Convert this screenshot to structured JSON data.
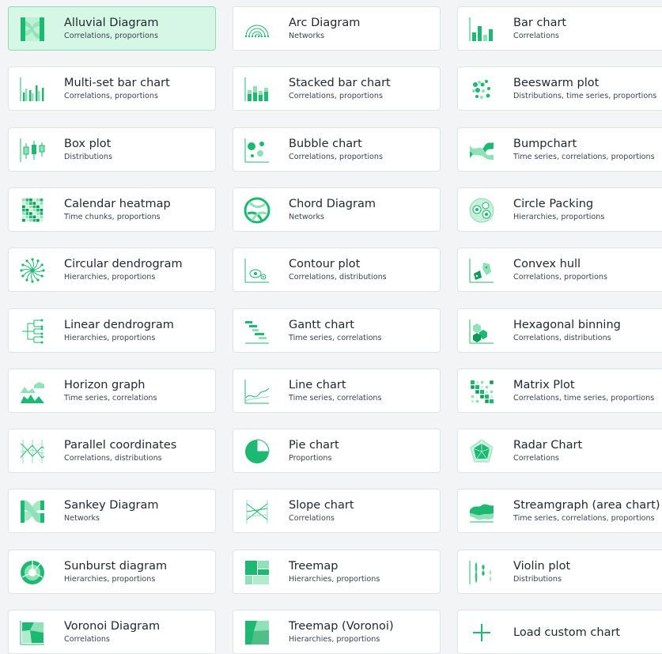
{
  "accent_color": "#1db872",
  "charts": [
    {
      "name": "Alluvial Diagram",
      "desc": "Correlations, proportions",
      "icon": "alluvial-diagram-icon",
      "selected": true
    },
    {
      "name": "Arc Diagram",
      "desc": "Networks",
      "icon": "arc-diagram-icon"
    },
    {
      "name": "Bar chart",
      "desc": "Correlations",
      "icon": "bar-chart-icon"
    },
    {
      "name": "Multi-set bar chart",
      "desc": "Correlations, proportions",
      "icon": "multi-set-bar-chart-icon"
    },
    {
      "name": "Stacked bar chart",
      "desc": "Correlations, proportions",
      "icon": "stacked-bar-chart-icon"
    },
    {
      "name": "Beeswarm plot",
      "desc": "Distributions, time series, proportions",
      "icon": "beeswarm-plot-icon"
    },
    {
      "name": "Box plot",
      "desc": "Distributions",
      "icon": "box-plot-icon"
    },
    {
      "name": "Bubble chart",
      "desc": "Correlations, proportions",
      "icon": "bubble-chart-icon"
    },
    {
      "name": "Bumpchart",
      "desc": "Time series, correlations, proportions",
      "icon": "bumpchart-icon"
    },
    {
      "name": "Calendar heatmap",
      "desc": "Time chunks, proportions",
      "icon": "calendar-heatmap-icon"
    },
    {
      "name": "Chord Diagram",
      "desc": "Networks",
      "icon": "chord-diagram-icon"
    },
    {
      "name": "Circle Packing",
      "desc": "Hierarchies, proportions",
      "icon": "circle-packing-icon"
    },
    {
      "name": "Circular dendrogram",
      "desc": "Hierarchies, proportions",
      "icon": "circular-dendrogram-icon"
    },
    {
      "name": "Contour plot",
      "desc": "Correlations, distributions",
      "icon": "contour-plot-icon"
    },
    {
      "name": "Convex hull",
      "desc": "Correlations, proportions",
      "icon": "convex-hull-icon"
    },
    {
      "name": "Linear dendrogram",
      "desc": "Hierarchies, proportions",
      "icon": "linear-dendrogram-icon"
    },
    {
      "name": "Gantt chart",
      "desc": "Time series, correlations",
      "icon": "gantt-chart-icon"
    },
    {
      "name": "Hexagonal binning",
      "desc": "Correlations, distributions",
      "icon": "hexagonal-binning-icon"
    },
    {
      "name": "Horizon graph",
      "desc": "Time series, correlations",
      "icon": "horizon-graph-icon"
    },
    {
      "name": "Line chart",
      "desc": "Time series, correlations",
      "icon": "line-chart-icon"
    },
    {
      "name": "Matrix Plot",
      "desc": "Correlations, time series, proportions",
      "icon": "matrix-plot-icon"
    },
    {
      "name": "Parallel coordinates",
      "desc": "Correlations, distributions",
      "icon": "parallel-coordinates-icon"
    },
    {
      "name": "Pie chart",
      "desc": "Proportions",
      "icon": "pie-chart-icon"
    },
    {
      "name": "Radar Chart",
      "desc": "Correlations",
      "icon": "radar-chart-icon"
    },
    {
      "name": "Sankey Diagram",
      "desc": "Networks",
      "icon": "sankey-diagram-icon"
    },
    {
      "name": "Slope chart",
      "desc": "Correlations",
      "icon": "slope-chart-icon"
    },
    {
      "name": "Streamgraph (area chart)",
      "desc": "Time series, correlations, proportions",
      "icon": "streamgraph-icon"
    },
    {
      "name": "Sunburst diagram",
      "desc": "Hierarchies, proportions",
      "icon": "sunburst-diagram-icon"
    },
    {
      "name": "Treemap",
      "desc": "Hierarchies, proportions",
      "icon": "treemap-icon"
    },
    {
      "name": "Violin plot",
      "desc": "Distributions",
      "icon": "violin-plot-icon"
    },
    {
      "name": "Voronoi Diagram",
      "desc": "Correlations",
      "icon": "voronoi-diagram-icon"
    },
    {
      "name": "Treemap (Voronoi)",
      "desc": "Hierarchies, proportions",
      "icon": "treemap-voronoi-icon"
    },
    {
      "name": "Load custom chart",
      "desc": "",
      "icon": "plus-icon",
      "custom": true
    }
  ]
}
